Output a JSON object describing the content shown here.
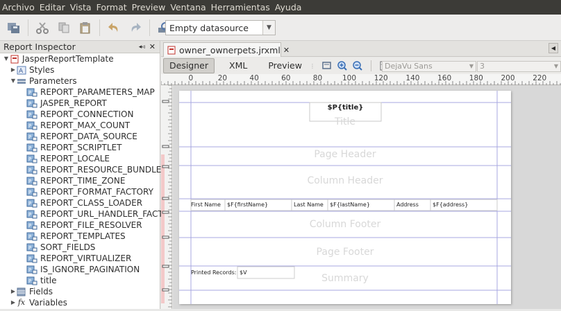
{
  "menu": [
    "Archivo",
    "Editar",
    "Vista",
    "Format",
    "Preview",
    "Ventana",
    "Herramientas",
    "Ayuda"
  ],
  "toolbar": {
    "datasource": "Empty datasource"
  },
  "inspector": {
    "title": "Report Inspector",
    "root": "JasperReportTemplate",
    "styles": "Styles",
    "parameters": "Parameters",
    "params": [
      "REPORT_PARAMETERS_MAP",
      "JASPER_REPORT",
      "REPORT_CONNECTION",
      "REPORT_MAX_COUNT",
      "REPORT_DATA_SOURCE",
      "REPORT_SCRIPTLET",
      "REPORT_LOCALE",
      "REPORT_RESOURCE_BUNDLE",
      "REPORT_TIME_ZONE",
      "REPORT_FORMAT_FACTORY",
      "REPORT_CLASS_LOADER",
      "REPORT_URL_HANDLER_FACTO",
      "REPORT_FILE_RESOLVER",
      "REPORT_TEMPLATES",
      "SORT_FIELDS",
      "REPORT_VIRTUALIZER",
      "IS_IGNORE_PAGINATION",
      "title"
    ],
    "fields": "Fields",
    "variables": "Variables"
  },
  "editor": {
    "tab": "owner_ownerpets.jrxml",
    "views": [
      "Designer",
      "XML",
      "Preview"
    ],
    "font": "DejaVu Sans",
    "size": "3",
    "ruler": [
      "0",
      "20",
      "40",
      "60",
      "80",
      "100",
      "120",
      "140",
      "160",
      "180",
      "200",
      "220"
    ]
  },
  "report": {
    "title_field": "$P{title}",
    "bands": [
      "Title",
      "Page Header",
      "Column Header",
      "Column Footer",
      "Page Footer",
      "Summary"
    ],
    "detail": [
      {
        "label": "First Name",
        "field": "$F{firstName}"
      },
      {
        "label": "Last Name",
        "field": "$F{lastName}"
      },
      {
        "label": "Address",
        "field": "$F{address}"
      }
    ],
    "printed_label": "Printed Records:",
    "printed_field": "$V"
  }
}
